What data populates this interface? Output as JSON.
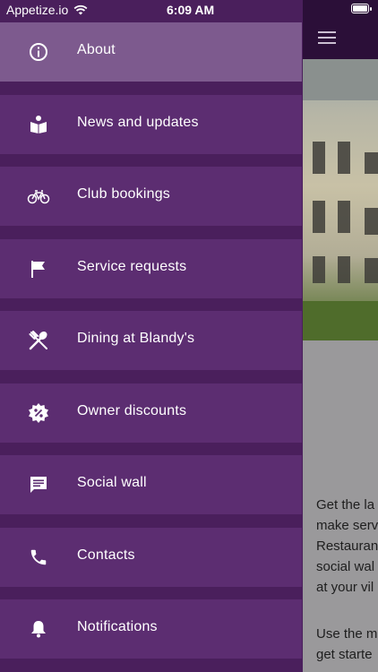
{
  "status_bar": {
    "carrier": "Appetize.io",
    "time": "6:09 AM"
  },
  "menu": {
    "items": [
      {
        "label": "About",
        "icon": "info-icon",
        "active": true
      },
      {
        "label": "News and updates",
        "icon": "reader-icon",
        "active": false
      },
      {
        "label": "Club bookings",
        "icon": "bicycle-icon",
        "active": false
      },
      {
        "label": "Service requests",
        "icon": "flag-icon",
        "active": false
      },
      {
        "label": "Dining at Blandy's",
        "icon": "cutlery-icon",
        "active": false
      },
      {
        "label": "Owner discounts",
        "icon": "discount-badge-icon",
        "active": false
      },
      {
        "label": "Social wall",
        "icon": "chat-icon",
        "active": false
      },
      {
        "label": "Contacts",
        "icon": "phone-icon",
        "active": false
      },
      {
        "label": "Notifications",
        "icon": "bell-icon",
        "active": false
      }
    ]
  },
  "background": {
    "paragraph_1": [
      "Get the la",
      "make serv",
      "Restauran",
      "social wal",
      "at your vil"
    ],
    "paragraph_2": [
      "Use the m",
      "get starte"
    ]
  },
  "colors": {
    "drawer_item": "#5c2d71",
    "drawer_separator": "#4a1f5c",
    "active_item": "#7d5a8e",
    "header": "#2b0f38"
  }
}
